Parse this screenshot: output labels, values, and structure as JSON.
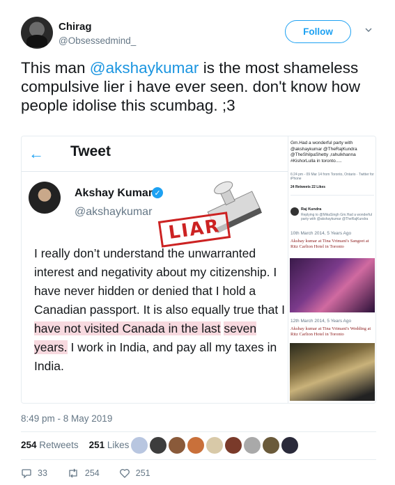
{
  "header": {
    "display_name": "Chirag",
    "handle": "@Obsessedmind_",
    "follow_label": "Follow"
  },
  "tweet": {
    "text_pre": "This man ",
    "mention": "@akshaykumar",
    "text_post": " is the most shameless compulsive lier i have ever seen. don't know how people idolise this scumbag. ;3"
  },
  "media": {
    "screen_title": "Tweet",
    "quoted_name": "Akshay Kumar",
    "quoted_handle": "@akshaykumar",
    "stamp_label": "LIAR",
    "body_part1": "I really don’t understand the unwarranted interest and negativity about my citizenship. I have never hidden or denied that I hold a Canadian passport. It is also equally true that I ",
    "body_highlight_1": "have not visited Canada in the last",
    "body_highlight_2": "seven years.",
    "body_part2": " I work in India, and pay all my taxes in India.",
    "side": {
      "tweet_text": "Gm.Had a wonderful party with @akshaykumar @TheRajKundra @TheShilpaShetty ,rahulkhanna #KishorLulla in toronto.....",
      "meta": "6:24 pm - 09 Mar 14 from Toronto, Ontario · Twitter for iPhone",
      "stats": "24 Retweets 22 Likes",
      "reply_author": "Raj Kundra",
      "reply_text": "Replying to @MikaSingh Gm.Had a wonderful party with @akshaykumar @TheRajKundra",
      "date1": "10th March 2014, 5 Years Ago",
      "headline1": "Akshay kumar at Tina Vrimani's Sangeet at Ritz Carlton Hotel in Toronto",
      "date2": "12th March 2014, 5 Years Ago",
      "headline2": "Akshay kumar at Tina Vrimani's Wedding at Ritz Carlton Hotel in Toronto"
    }
  },
  "footer": {
    "timestamp": "8:49 pm - 8 May 2019",
    "retweets_count": "254",
    "retweets_label": "Retweets",
    "likes_count": "251",
    "likes_label": "Likes",
    "reply_count": "33",
    "retweet_action_count": "254",
    "like_action_count": "251"
  },
  "colors": {
    "accent": "#1da1f2",
    "mention": "#1b95e0",
    "highlight": "#f7d9df",
    "stamp": "#cc2222"
  }
}
